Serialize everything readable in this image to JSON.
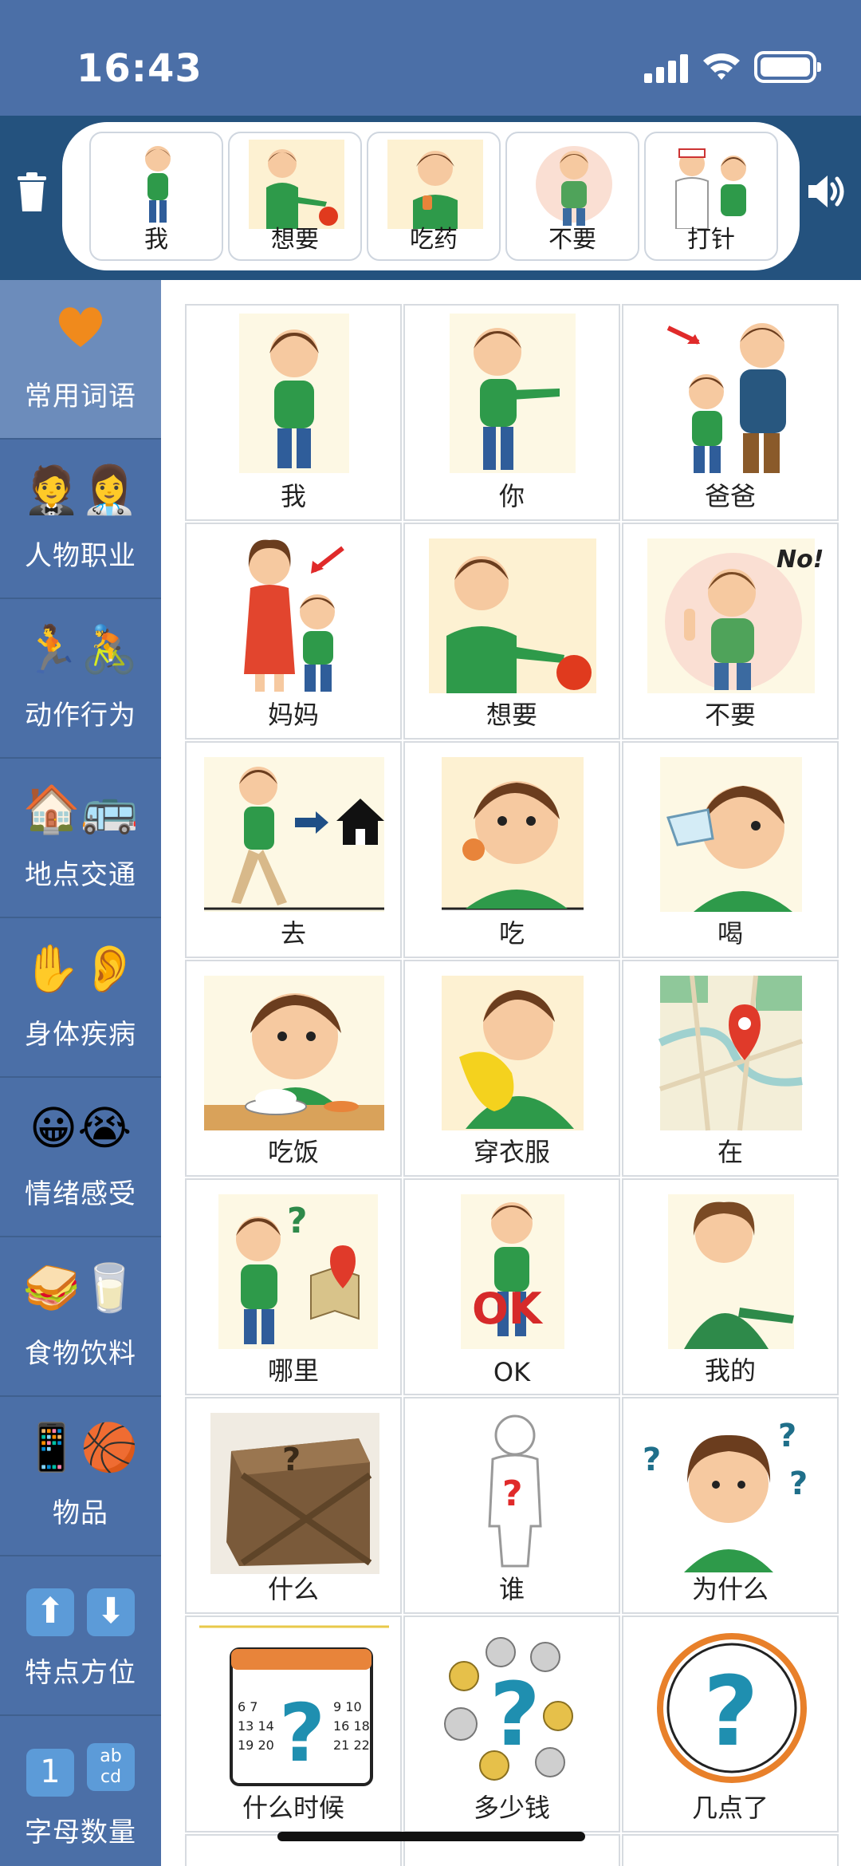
{
  "status": {
    "time": "16:43"
  },
  "sentence_strip": [
    {
      "label": "我",
      "icon": "boy-self-icon"
    },
    {
      "label": "想要",
      "icon": "want-icon"
    },
    {
      "label": "吃药",
      "icon": "take-medicine-icon"
    },
    {
      "label": "不要",
      "icon": "dont-want-icon"
    },
    {
      "label": "打针",
      "icon": "injection-icon"
    }
  ],
  "sidebar": {
    "items": [
      {
        "label": "常用词语",
        "emoji": "🧡",
        "active": true
      },
      {
        "label": "人物职业",
        "emoji": "🤵👩‍⚕️"
      },
      {
        "label": "动作行为",
        "emoji": "🏃🚴"
      },
      {
        "label": "地点交通",
        "emoji": "🏠🚌"
      },
      {
        "label": "身体疾病",
        "emoji": "✋👂"
      },
      {
        "label": "情绪感受",
        "emoji": "😀😭"
      },
      {
        "label": "食物饮料",
        "emoji": "🥪🥛"
      },
      {
        "label": "物品",
        "emoji": "📱🏀"
      },
      {
        "label": "特点方位",
        "emoji": "⬆⬇"
      },
      {
        "label": "字母数量",
        "emoji": "1 abcd"
      }
    ]
  },
  "grid": {
    "tiles": [
      {
        "label": "我",
        "icon": "me-icon"
      },
      {
        "label": "你",
        "icon": "you-icon"
      },
      {
        "label": "爸爸",
        "icon": "dad-icon"
      },
      {
        "label": "妈妈",
        "icon": "mom-icon"
      },
      {
        "label": "想要",
        "icon": "want-icon"
      },
      {
        "label": "不要",
        "icon": "no-icon"
      },
      {
        "label": "去",
        "icon": "go-icon"
      },
      {
        "label": "吃",
        "icon": "eat-icon"
      },
      {
        "label": "喝",
        "icon": "drink-icon"
      },
      {
        "label": "吃饭",
        "icon": "eat-meal-icon"
      },
      {
        "label": "穿衣服",
        "icon": "dress-icon"
      },
      {
        "label": "在",
        "icon": "map-location-icon"
      },
      {
        "label": "哪里",
        "icon": "where-icon"
      },
      {
        "label": "OK",
        "icon": "ok-icon"
      },
      {
        "label": "我的",
        "icon": "mine-icon"
      },
      {
        "label": "什么",
        "icon": "mystery-box-icon"
      },
      {
        "label": "谁",
        "icon": "who-icon"
      },
      {
        "label": "为什么",
        "icon": "why-icon"
      },
      {
        "label": "什么时候",
        "icon": "calendar-question-icon"
      },
      {
        "label": "多少钱",
        "icon": "coins-question-icon"
      },
      {
        "label": "几点了",
        "icon": "clock-question-icon"
      }
    ]
  },
  "colors": {
    "header_blue": "#4b6fa7",
    "strip_navy": "#24527e",
    "sidebar_active": "#6c8cbb"
  }
}
